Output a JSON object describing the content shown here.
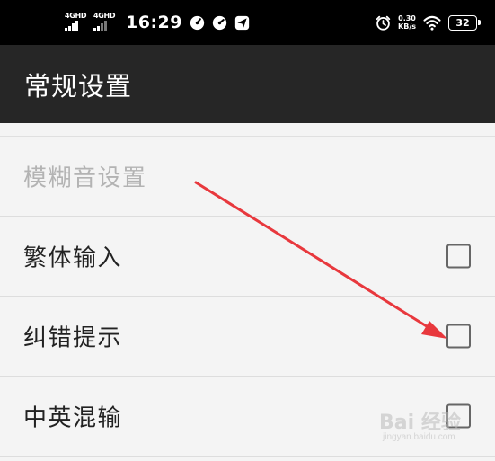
{
  "status_bar": {
    "signal1_label": "4GHD",
    "signal2_label": "4GHD",
    "time": "16:29",
    "net_speed_value": "0.30",
    "net_speed_unit": "KB/s",
    "battery_level": "32"
  },
  "app_bar": {
    "title": "常规设置"
  },
  "settings": {
    "items": [
      {
        "label": "模糊音设置",
        "enabled": false,
        "has_checkbox": false
      },
      {
        "label": "繁体输入",
        "enabled": true,
        "has_checkbox": true,
        "checked": false
      },
      {
        "label": "纠错提示",
        "enabled": true,
        "has_checkbox": true,
        "checked": false
      },
      {
        "label": "中英混输",
        "enabled": true,
        "has_checkbox": true,
        "checked": false
      }
    ]
  },
  "annotation": {
    "arrow_color": "#e8383d"
  },
  "watermark": {
    "main": "Bai 经验",
    "sub": "jingyan.baidu.com"
  },
  "colors": {
    "status_bar_bg": "#000000",
    "app_bar_bg": "#262626",
    "list_bg": "#f4f4f4",
    "disabled_text": "#b3b3b3"
  }
}
